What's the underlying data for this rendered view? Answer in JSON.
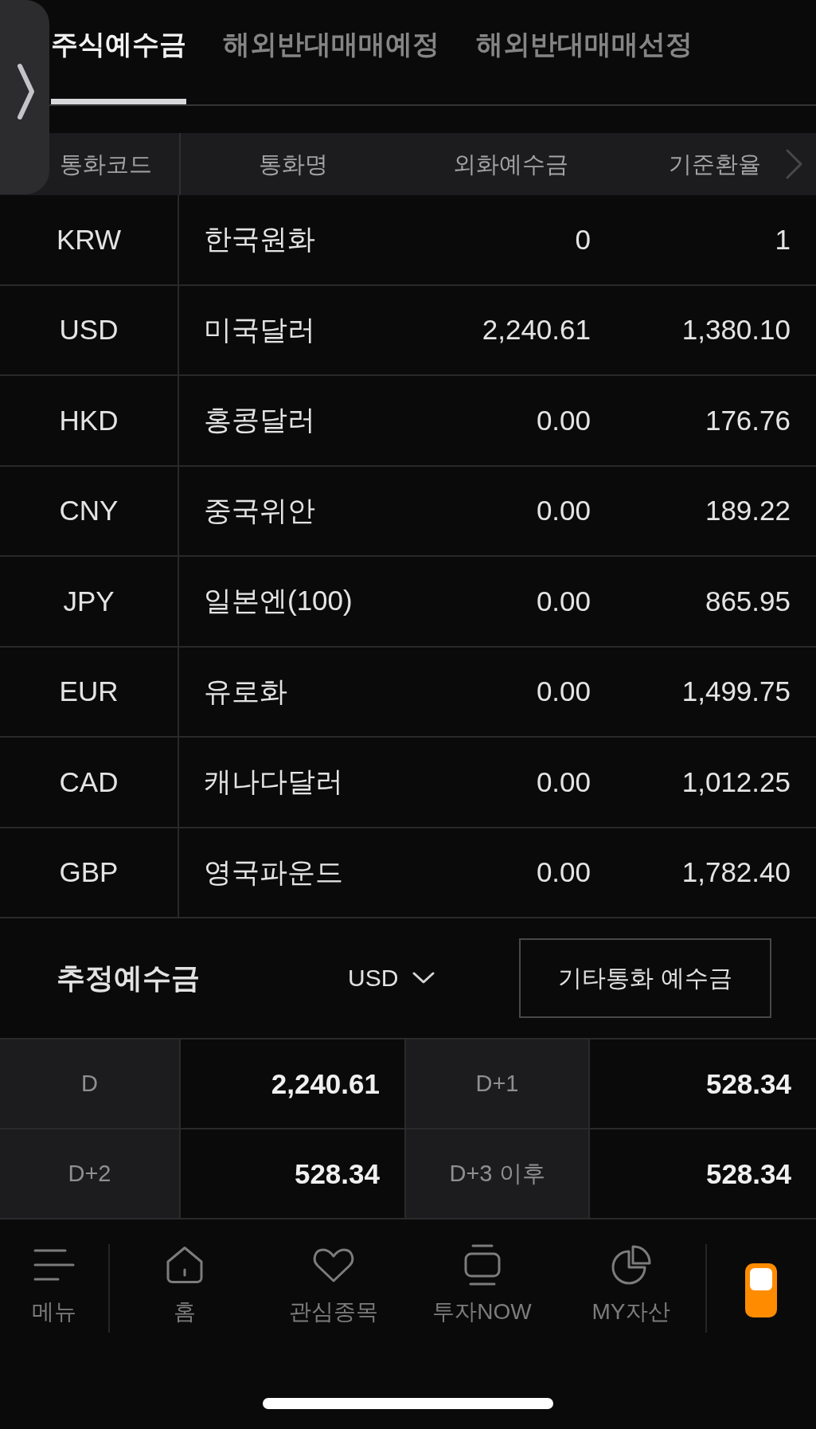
{
  "tabs": [
    {
      "label": "주식예수금",
      "selected": true
    },
    {
      "label": "해외반대매매예정",
      "selected": false
    },
    {
      "label": "해외반대매매선정",
      "selected": false
    }
  ],
  "table": {
    "columns": [
      "통화코드",
      "통화명",
      "외화예수금",
      "기준환율"
    ],
    "rows": [
      [
        "KRW",
        "한국원화",
        "0",
        "1"
      ],
      [
        "USD",
        "미국달러",
        "2,240.61",
        "1,380.10"
      ],
      [
        "HKD",
        "홍콩달러",
        "0.00",
        "176.76"
      ],
      [
        "CNY",
        "중국위안",
        "0.00",
        "189.22"
      ],
      [
        "JPY",
        "일본엔(100)",
        "0.00",
        "865.95"
      ],
      [
        "EUR",
        "유로화",
        "0.00",
        "1,499.75"
      ],
      [
        "CAD",
        "캐나다달러",
        "0.00",
        "1,012.25"
      ],
      [
        "GBP",
        "영국파운드",
        "0.00",
        "1,782.40"
      ]
    ]
  },
  "estimated_deposit": {
    "title": "추정예수금",
    "currency": "USD",
    "button": "기타통화 예수금",
    "items": [
      {
        "label": "D",
        "value": "2,240.61"
      },
      {
        "label": "D+1",
        "value": "528.34"
      },
      {
        "label": "D+2",
        "value": "528.34"
      },
      {
        "label": "D+3 이후",
        "value": "528.34"
      }
    ]
  },
  "bottom_nav": {
    "items": [
      {
        "label": "메뉴"
      },
      {
        "label": "홈"
      },
      {
        "label": "관심종목"
      },
      {
        "label": "투자NOW"
      },
      {
        "label": "MY자산"
      }
    ]
  }
}
